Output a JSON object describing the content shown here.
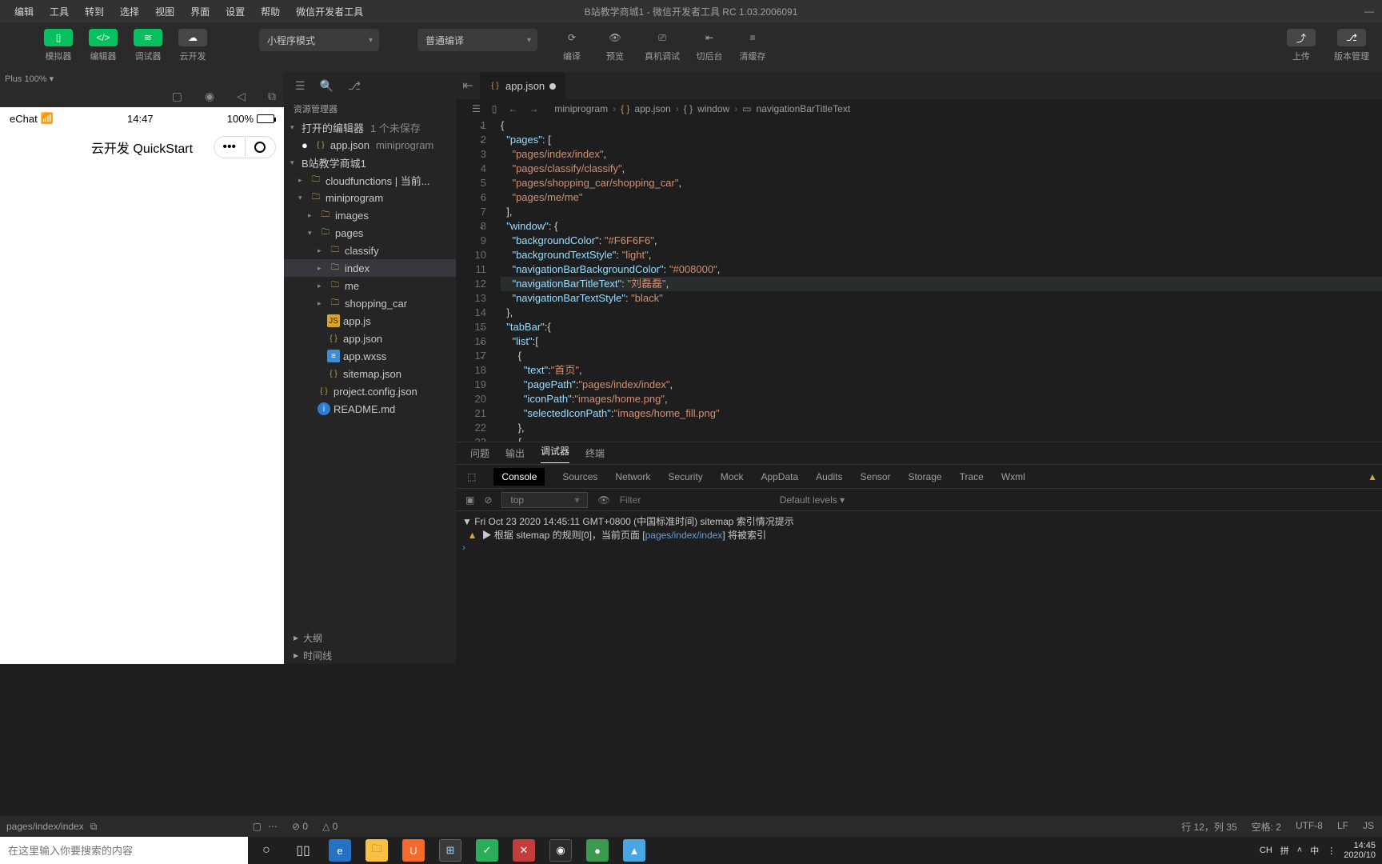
{
  "menu": {
    "items": [
      "编辑",
      "工具",
      "转到",
      "选择",
      "视图",
      "界面",
      "设置",
      "帮助",
      "微信开发者工具"
    ],
    "title": "B站教学商城1 - 微信开发者工具 RC 1.03.2006091"
  },
  "toolbar": {
    "simulator": "模拟器",
    "editor": "编辑器",
    "debugger": "调试器",
    "cloud": "云开发",
    "mode": "小程序模式",
    "compile_mode": "普通编译",
    "compile": "编译",
    "preview": "预览",
    "remote": "真机调试",
    "background": "切后台",
    "clear": "清缓存",
    "upload": "上传",
    "version": "版本管理"
  },
  "sim": {
    "device": "Plus 100% ▾",
    "carrier": "eChat",
    "wifi": "⋮",
    "time": "14:47",
    "battery_pct": "100%",
    "nav_title": "云开发 QuickStart"
  },
  "explorer": {
    "title": "资源管理器",
    "open_editors": "打开的编辑器",
    "unsaved": "1 个未保存",
    "active_file": "app.json",
    "active_file_dim": "miniprogram",
    "project": "B站教学商城1",
    "tree": {
      "cloudfunctions": "cloudfunctions | 当前...",
      "miniprogram": "miniprogram",
      "images": "images",
      "pages": "pages",
      "classify": "classify",
      "index": "index",
      "me": "me",
      "shopping_car": "shopping_car",
      "appjs": "app.js",
      "appjson": "app.json",
      "appwxss": "app.wxss",
      "sitemap": "sitemap.json",
      "projectconfig": "project.config.json",
      "readme": "README.md"
    },
    "outline": "大纲",
    "timeline": "时间线",
    "status_err": "0",
    "status_warn": "0"
  },
  "editor": {
    "tab_file": "app.json",
    "breadcrumb": [
      "miniprogram",
      "app.json",
      "window",
      "navigationBarTitleText"
    ],
    "code": {
      "l1": "{",
      "l2": "  \"pages\": [",
      "l3": "    \"pages/index/index\",",
      "l4": "    \"pages/classify/classify\",",
      "l5": "    \"pages/shopping_car/shopping_car\",",
      "l6": "    \"pages/me/me\"",
      "l7": "  ],",
      "l8": "  \"window\": {",
      "l9": "    \"backgroundColor\": \"#F6F6F6\",",
      "l10": "    \"backgroundTextStyle\": \"light\",",
      "l11": "    \"navigationBarBackgroundColor\": \"#008000\",",
      "l12": "    \"navigationBarTitleText\": \"刘磊磊\",",
      "l13": "    \"navigationBarTextStyle\": \"black\"",
      "l14": "  },",
      "l15": "  \"tabBar\":{",
      "l16": "    \"list\":[",
      "l17": "      {",
      "l18": "        \"text\":\"首页\",",
      "l19": "        \"pagePath\":\"pages/index/index\",",
      "l20": "        \"iconPath\":\"images/home.png\",",
      "l21": "        \"selectedIconPath\":\"images/home_fill.png\"",
      "l22": "      },",
      "l23": "      {"
    }
  },
  "console": {
    "tabs": [
      "问题",
      "输出",
      "调试器",
      "终端"
    ],
    "devtabs": [
      "Console",
      "Sources",
      "Network",
      "Security",
      "Mock",
      "AppData",
      "Audits",
      "Sensor",
      "Storage",
      "Trace",
      "Wxml"
    ],
    "context": "top",
    "filter_ph": "Filter",
    "levels": "Default levels ▾",
    "line1": "Fri Oct 23 2020 14:45:11 GMT+0800 (中国标准时间) sitemap 索引情况提示",
    "line2_a": "▶ 根据 sitemap 的规则[0]，当前页面 [",
    "line2_b": "pages/index/index",
    "line2_c": "] 将被索引"
  },
  "status_sim": {
    "page": "pages/index/index"
  },
  "status_ed": {
    "pos": "行 12，列 35",
    "spaces": "空格: 2",
    "enc": "UTF-8",
    "eol": "LF",
    "lang": "JS"
  },
  "taskbar": {
    "search_ph": "在这里输入你要搜索的内容",
    "tray": {
      "ime1": "CH",
      "ime2": "拼",
      "up": "˄",
      "ime3": "中",
      "sp": "⋮",
      "time": "14:45",
      "date": "2020/10"
    }
  }
}
